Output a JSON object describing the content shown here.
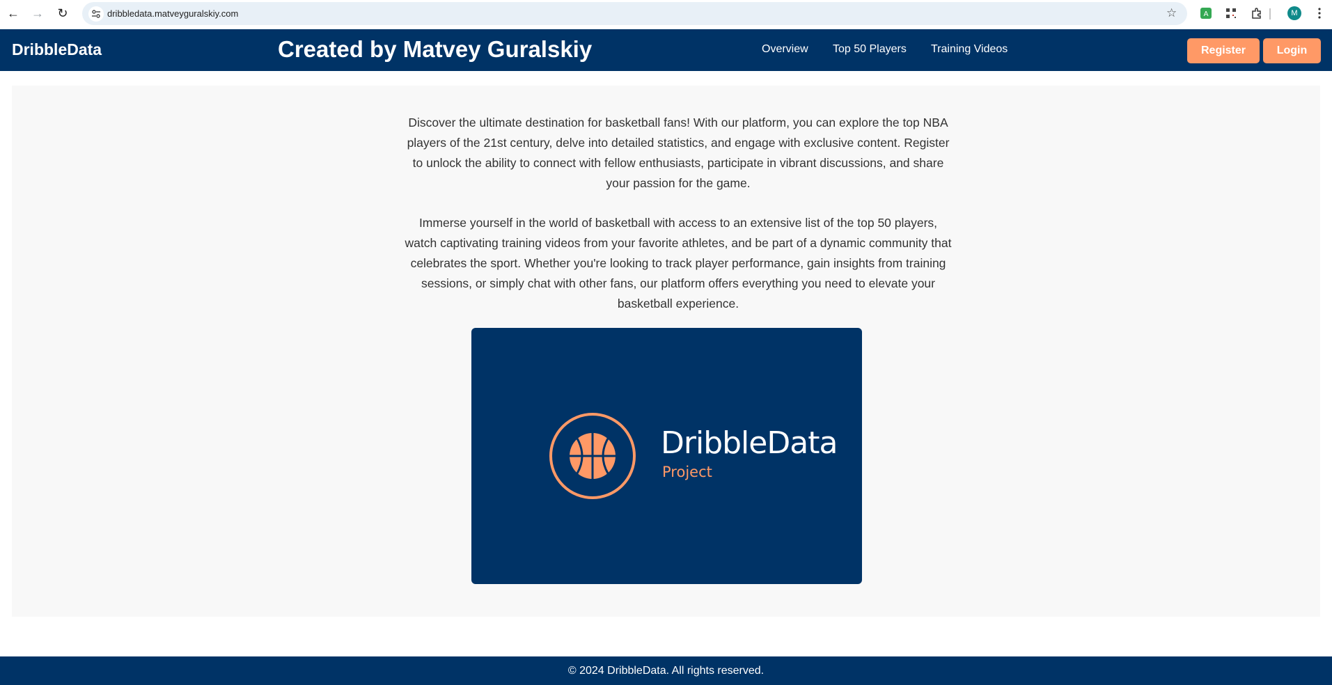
{
  "browser": {
    "url": "dribbledata.matveyguralskiy.com",
    "avatar_letter": "M"
  },
  "header": {
    "logo": "DribbleData",
    "title": "Created by Matvey Guralskiy",
    "nav": [
      "Overview",
      "Top 50 Players",
      "Training Videos"
    ],
    "register_label": "Register",
    "login_label": "Login"
  },
  "main": {
    "paragraph_1": "Discover the ultimate destination for basketball fans! With our platform, you can explore the top NBA players of the 21st century, delve into detailed statistics, and engage with exclusive content. Register to unlock the ability to connect with fellow enthusiasts, participate in vibrant discussions, and share your passion for the game.",
    "paragraph_2": "Immerse yourself in the world of basketball with access to an extensive list of the top 50 players, watch captivating training videos from your favorite athletes, and be part of a dynamic community that celebrates the sport. Whether you're looking to track player performance, gain insights from training sessions, or simply chat with other fans, our platform offers everything you need to elevate your basketball experience.",
    "hero": {
      "brand_name": "DribbleData",
      "brand_sub": "Project"
    }
  },
  "footer": {
    "text": "© 2024 DribbleData. All rights reserved."
  },
  "colors": {
    "navy": "#003366",
    "accent_orange": "#ff9966"
  }
}
